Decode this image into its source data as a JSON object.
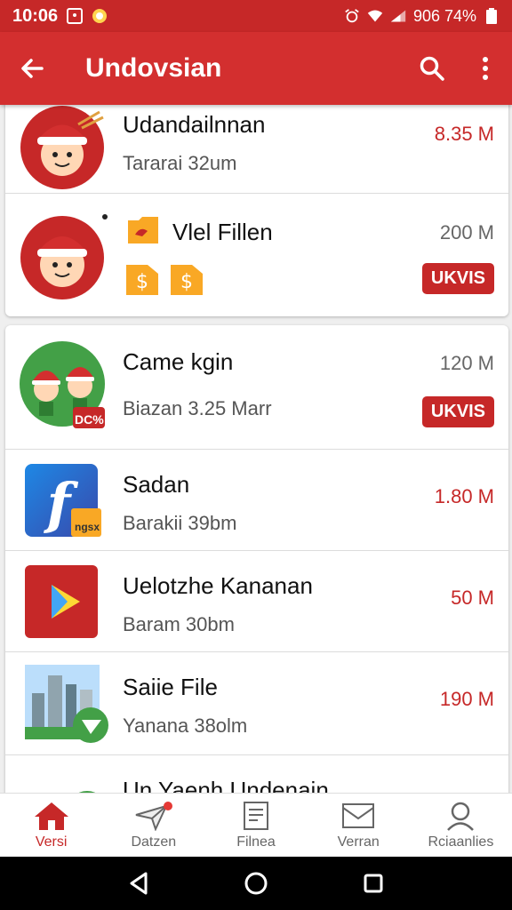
{
  "status_bar": {
    "time": "10:06",
    "right_text": "906 74%"
  },
  "app_bar": {
    "title": "Undovsian"
  },
  "card1": [
    {
      "name": "Udandailnnan",
      "sub": "Tararai 32um",
      "size": "8.35 M",
      "size_color": "red",
      "badge": ""
    },
    {
      "name": "Vlel Fillen",
      "sub": "",
      "size": "200 M",
      "size_color": "gray",
      "badge": "UKVIS"
    }
  ],
  "card2": [
    {
      "name": "Came kgin",
      "sub": "Biazan 3.25 Marr",
      "size": "120 M",
      "size_color": "gray",
      "badge": "UKVIS",
      "thumb_badge": "DC%"
    },
    {
      "name": "Sadan",
      "sub": "Barakii 39bm",
      "size": "1.80 M",
      "size_color": "red",
      "badge": "",
      "thumb_badge": "ngsx"
    },
    {
      "name": "Uelotzhe Kananan",
      "sub": "Baram 30bm",
      "size": "50 M",
      "size_color": "red",
      "badge": ""
    },
    {
      "name": "Saiie File",
      "sub": "Yanana 38olm",
      "size": "190 M",
      "size_color": "red",
      "badge": ""
    },
    {
      "name": "Un Yaenh Undenain",
      "sub": "",
      "size": "",
      "size_color": "red",
      "badge": ""
    }
  ],
  "bottom_nav": [
    {
      "label": "Versi",
      "icon": "home-icon",
      "active": true
    },
    {
      "label": "Datzen",
      "icon": "plane-icon",
      "active": false
    },
    {
      "label": "Filnea",
      "icon": "document-icon",
      "active": false
    },
    {
      "label": "Verran",
      "icon": "inbox-icon",
      "active": false
    },
    {
      "label": "Rciaanlies",
      "icon": "person-icon",
      "active": false
    }
  ],
  "colors": {
    "primary": "#d32f2f",
    "status_bar": "#c62828",
    "accent_red": "#c62828"
  }
}
